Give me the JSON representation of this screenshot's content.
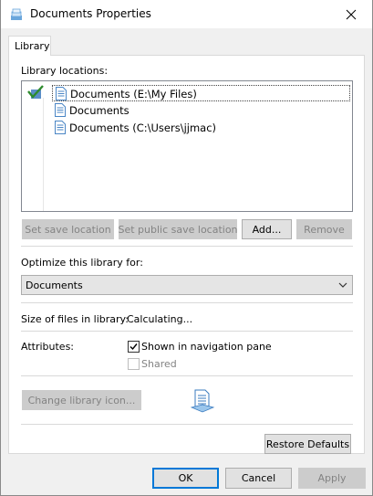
{
  "window": {
    "title": "Documents Properties"
  },
  "tabs": [
    {
      "label": "Library"
    }
  ],
  "library": {
    "locations_label": "Library locations:",
    "locations": [
      {
        "label": "Documents (E:\\My Files)",
        "selected": true,
        "default_save": true
      },
      {
        "label": "Documents",
        "selected": false,
        "default_save": false
      },
      {
        "label": "Documents (C:\\Users\\jjmac)",
        "selected": false,
        "default_save": false
      }
    ],
    "buttons": {
      "set_save_location": "Set save location",
      "set_public_save_location": "Set public save location",
      "add": "Add...",
      "remove": "Remove"
    },
    "optimize_label": "Optimize this library for:",
    "optimize_value": "Documents",
    "size_label": "Size of files in library:",
    "size_value": "Calculating...",
    "attributes_label": "Attributes:",
    "attributes": {
      "shown_in_nav_label": "Shown in navigation pane",
      "shown_in_nav_checked": true,
      "shared_label": "Shared",
      "shared_checked": false,
      "shared_disabled": true
    },
    "change_icon_label": "Change library icon...",
    "restore_defaults_label": "Restore Defaults"
  },
  "dialog_buttons": {
    "ok": "OK",
    "cancel": "Cancel",
    "apply": "Apply"
  },
  "icons": {
    "title": "library-icon",
    "close": "close-icon",
    "location": "document-library-icon",
    "default_save": "checkmark-icon",
    "dropdown": "chevron-down-icon",
    "library_big": "document-library-icon"
  },
  "colors": {
    "accent": "#0078d7",
    "disabled_text": "#838383"
  }
}
